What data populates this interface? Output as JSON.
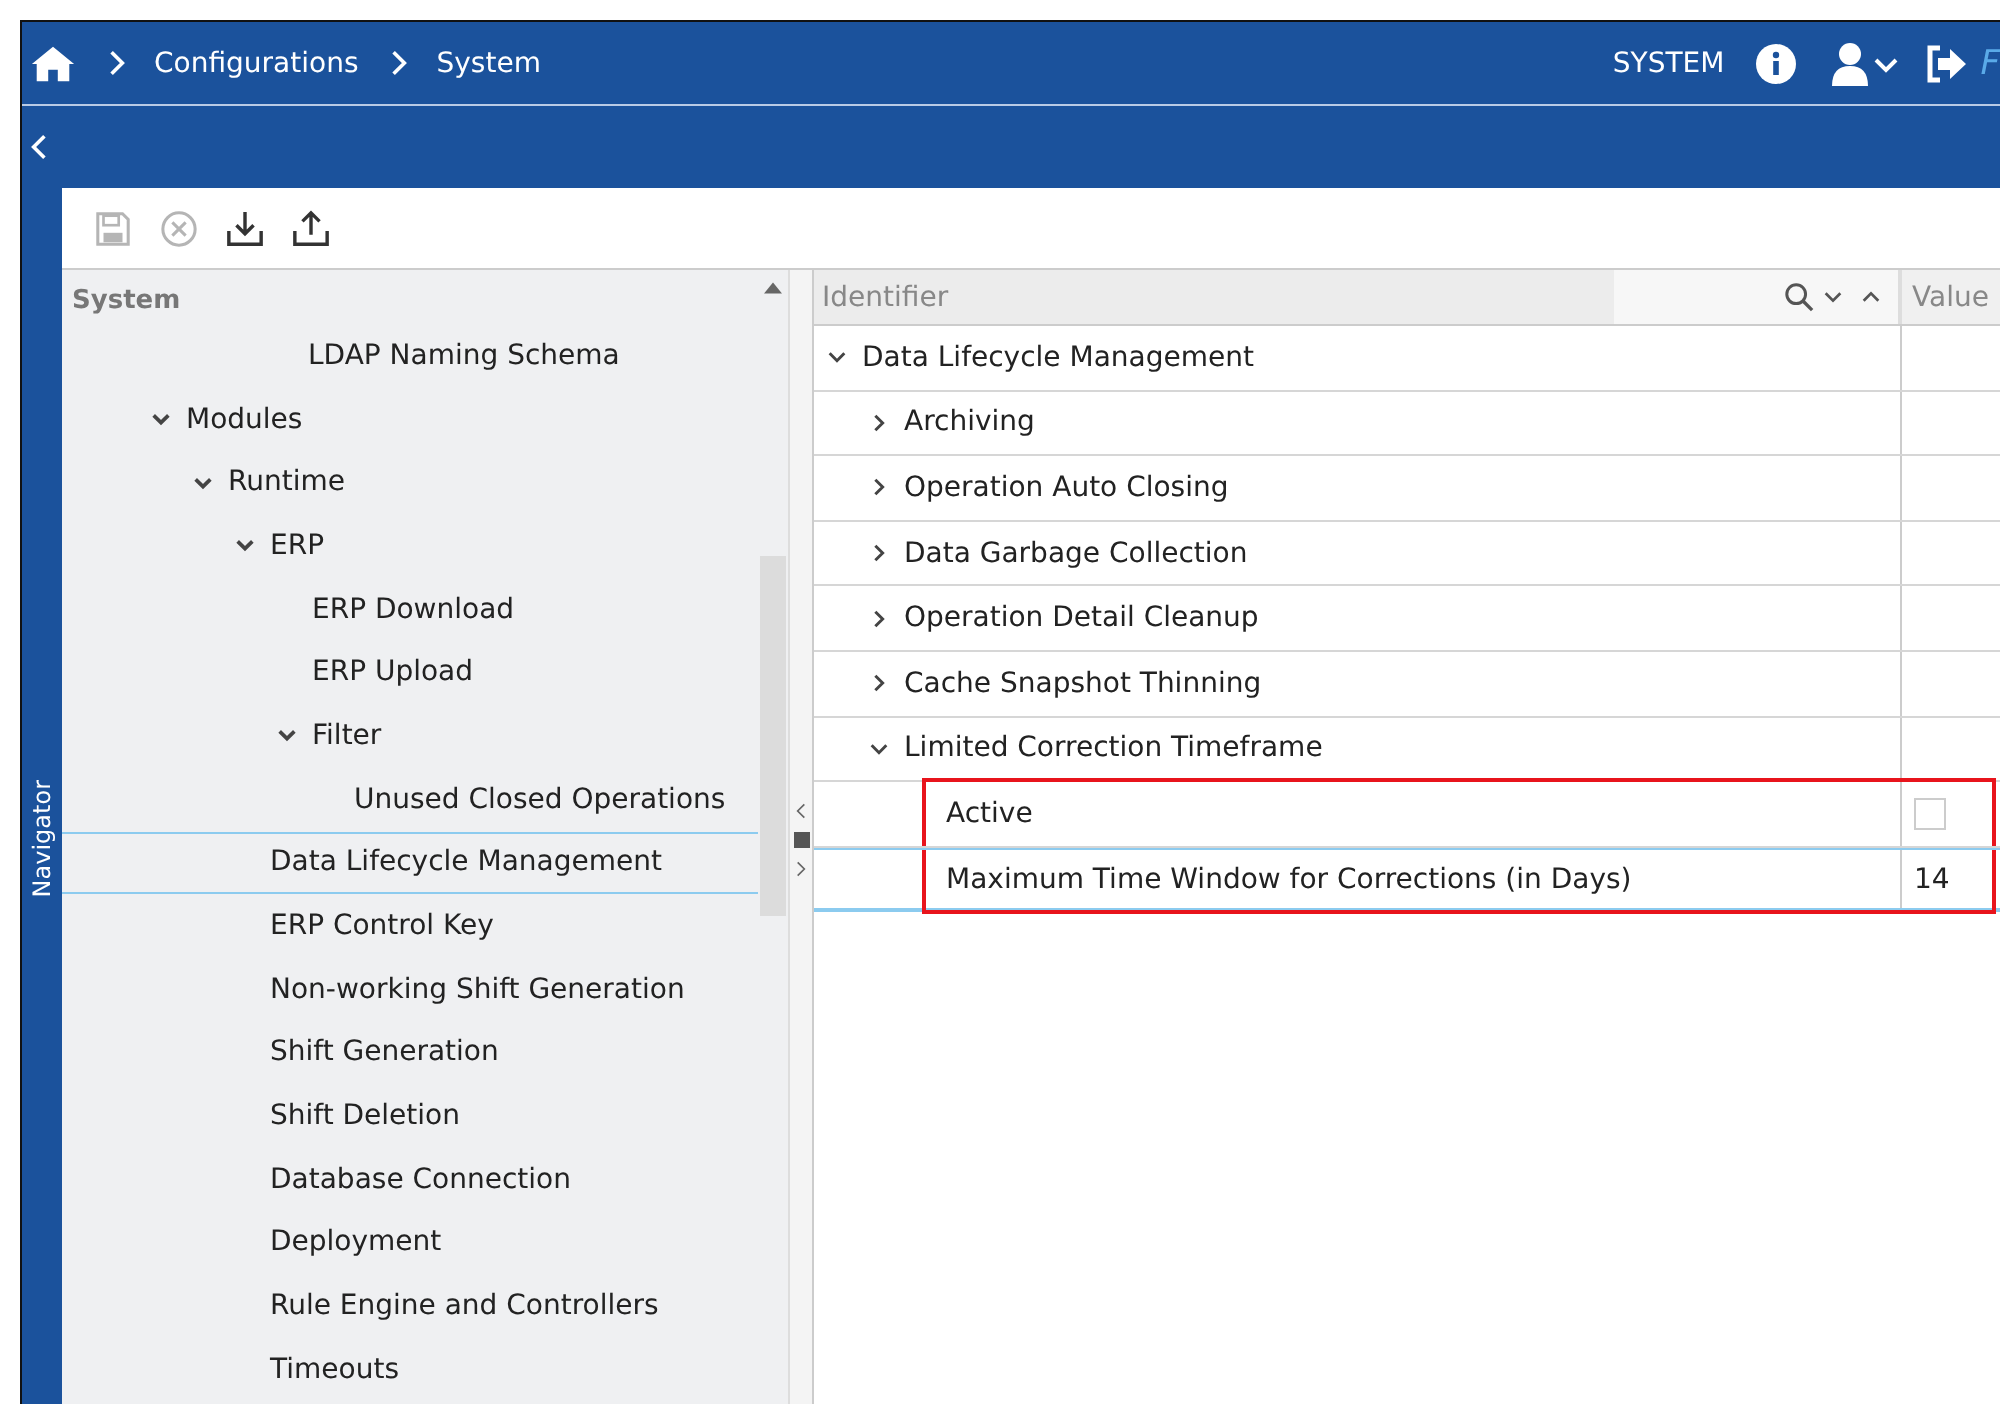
{
  "header": {
    "breadcrumbs": [
      "Configurations",
      "System"
    ],
    "user": "SYSTEM",
    "logo": "F"
  },
  "toolbar": [
    {
      "kind": "save",
      "disabled": true
    },
    {
      "kind": "cancel",
      "disabled": true
    },
    {
      "kind": "download",
      "disabled": false
    },
    {
      "kind": "upload",
      "disabled": false
    }
  ],
  "navigator": {
    "label": "Navigator",
    "title": "System",
    "scrolled_leaf": "LDAP Naming Schema",
    "tree": [
      {
        "label": "Modules",
        "expanded": true,
        "selected": false,
        "children": [
          {
            "label": "Runtime",
            "expanded": true,
            "selected": false,
            "children": [
              {
                "label": "ERP",
                "expanded": true,
                "selected": false,
                "children": [
                  {
                    "label": "ERP Download",
                    "selected": false
                  },
                  {
                    "label": "ERP Upload",
                    "selected": false
                  },
                  {
                    "label": "Filter",
                    "expanded": true,
                    "selected": false,
                    "children": [
                      {
                        "label": "Unused Closed Operations",
                        "selected": false
                      }
                    ]
                  }
                ]
              },
              {
                "label": "Data Lifecycle Management",
                "selected": true
              },
              {
                "label": "ERP Control Key",
                "selected": false
              },
              {
                "label": "Non-working Shift Generation",
                "selected": false
              },
              {
                "label": "Shift Generation",
                "selected": false
              },
              {
                "label": "Shift Deletion",
                "selected": false
              },
              {
                "label": "Database Connection",
                "selected": false
              },
              {
                "label": "Deployment",
                "selected": false
              },
              {
                "label": "Rule Engine and Controllers",
                "selected": false
              },
              {
                "label": "Timeouts",
                "selected": false
              }
            ]
          }
        ]
      }
    ]
  },
  "grid": {
    "columns": [
      "Identifier",
      "Value"
    ],
    "rows": [
      {
        "label": "Data Lifecycle Management",
        "kind": "group",
        "expanded": true,
        "selected": false,
        "highlighted": false,
        "children": [
          {
            "label": "Archiving",
            "kind": "group",
            "expanded": false,
            "selected": false,
            "highlighted": false
          },
          {
            "label": "Operation Auto Closing",
            "kind": "group",
            "expanded": false,
            "selected": false,
            "highlighted": false
          },
          {
            "label": "Data Garbage Collection",
            "kind": "group",
            "expanded": false,
            "selected": false,
            "highlighted": false
          },
          {
            "label": "Operation Detail Cleanup",
            "kind": "group",
            "expanded": false,
            "selected": false,
            "highlighted": false
          },
          {
            "label": "Cache Snapshot Thinning",
            "kind": "group",
            "expanded": false,
            "selected": false,
            "highlighted": false
          },
          {
            "label": "Limited Correction Timeframe",
            "kind": "group",
            "expanded": true,
            "selected": false,
            "highlighted": false,
            "children": [
              {
                "label": "Active",
                "kind": "checkbox",
                "checked": false,
                "selected": false,
                "highlighted": true
              },
              {
                "label": "Maximum Time Window for Corrections (in Days)",
                "kind": "number",
                "value": "14",
                "selected": true,
                "highlighted": true
              }
            ]
          }
        ]
      }
    ]
  }
}
